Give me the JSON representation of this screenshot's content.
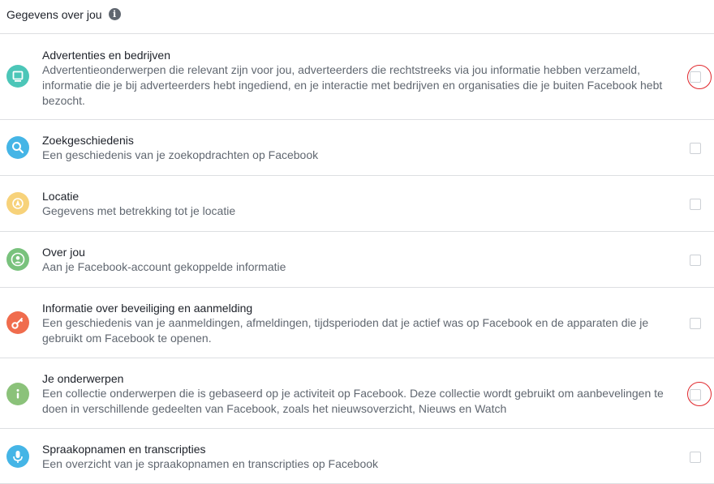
{
  "header": {
    "title": "Gegevens over jou",
    "info_icon": "info-icon"
  },
  "rows": [
    {
      "title": "Advertenties en bedrijven",
      "desc": "Advertentieonderwerpen die relevant zijn voor jou, adverteerders die rechtstreeks via jou informatie hebben verzameld, informatie die je bij adverteerders hebt ingediend, en je interactie met bedrijven en organisaties die je buiten Facebook hebt bezocht.",
      "icon": "monitor-icon",
      "color": "#4cc6b8",
      "checked": false
    },
    {
      "title": "Zoekgeschiedenis",
      "desc": "Een geschiedenis van je zoekopdrachten op Facebook",
      "icon": "search-icon",
      "color": "#45b5e6",
      "checked": false
    },
    {
      "title": "Locatie",
      "desc": "Gegevens met betrekking tot je locatie",
      "icon": "location-icon",
      "color": "#f7d27a",
      "checked": false
    },
    {
      "title": "Over jou",
      "desc": "Aan je Facebook-account gekoppelde informatie",
      "icon": "profile-icon",
      "color": "#79c27d",
      "checked": false
    },
    {
      "title": "Informatie over beveiliging en aanmelding",
      "desc": "Een geschiedenis van je aanmeldingen, afmeldingen, tijdsperioden dat je actief was op Facebook en de apparaten die je gebruikt om Facebook te openen.",
      "icon": "key-icon",
      "color": "#f06c4d",
      "checked": false
    },
    {
      "title": "Je onderwerpen",
      "desc": "Een collectie onderwerpen die is gebaseerd op je activiteit op Facebook. Deze collectie wordt gebruikt om aanbevelingen te doen in verschillende gedeelten van Facebook, zoals het nieuwsoverzicht, Nieuws en Watch",
      "icon": "info-icon",
      "color": "#8bc27a",
      "checked": false
    },
    {
      "title": "Spraakopnamen en transcripties",
      "desc": "Een overzicht van je spraakopnamen en transcripties op Facebook",
      "icon": "microphone-icon",
      "color": "#45b5e6",
      "checked": false
    }
  ]
}
